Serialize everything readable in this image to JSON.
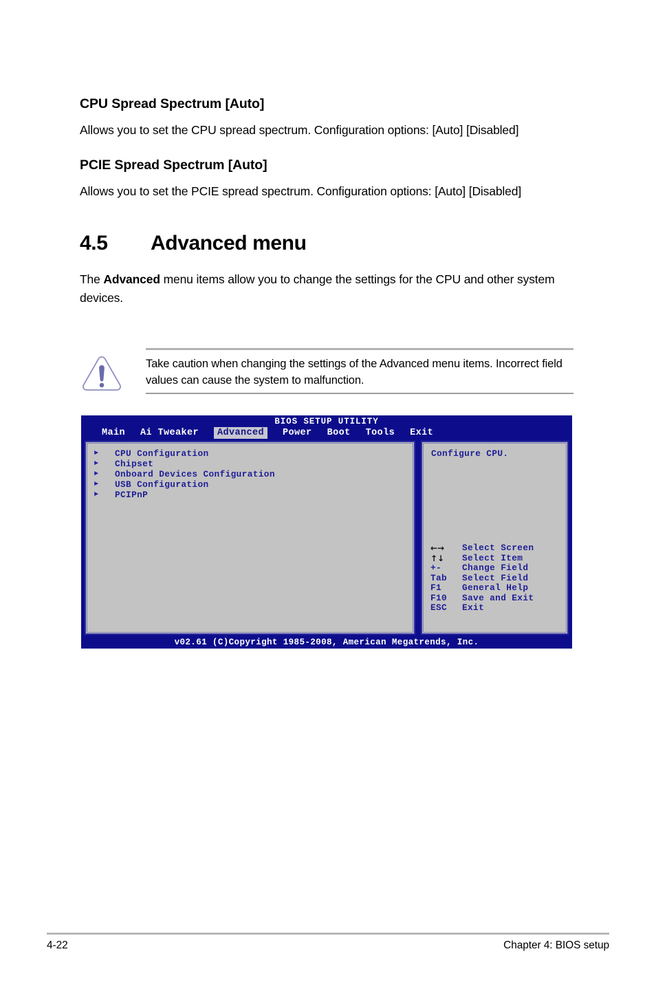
{
  "document": {
    "sections": [
      {
        "heading": "CPU Spread Spectrum [Auto]",
        "body": "Allows you to set the CPU spread spectrum. Configuration options: [Auto] [Disabled]"
      },
      {
        "heading": "PCIE Spread Spectrum [Auto]",
        "body": "Allows you to set the PCIE spread spectrum. Configuration options: [Auto] [Disabled]"
      }
    ],
    "section_heading": {
      "number": "4.5",
      "title": "Advanced menu"
    },
    "intro": {
      "prefix": "The ",
      "bold": "Advanced",
      "suffix": " menu items allow you to change the settings for the CPU and other system devices."
    },
    "note": {
      "icon": "warning-triangle-icon",
      "text": "Take caution when changing the settings of the Advanced menu items. Incorrect field values can cause the system to malfunction."
    },
    "footer": {
      "page_number": "4-22",
      "chapter": "Chapter 4: BIOS setup"
    }
  },
  "bios": {
    "title": "BIOS SETUP UTILITY",
    "tabs": [
      {
        "label": "Main",
        "active": false
      },
      {
        "label": "Ai Tweaker",
        "active": false
      },
      {
        "label": "Advanced",
        "active": true
      },
      {
        "label": "Power",
        "active": false
      },
      {
        "label": "Boot",
        "active": false
      },
      {
        "label": "Tools",
        "active": false
      },
      {
        "label": "Exit",
        "active": false
      }
    ],
    "menu_items": [
      {
        "arrow": "triangle-right-icon",
        "label": "CPU Configuration"
      },
      {
        "arrow": "triangle-right-icon",
        "label": "Chipset"
      },
      {
        "arrow": "triangle-right-icon",
        "label": "Onboard Devices Configuration"
      },
      {
        "arrow": "triangle-right-icon",
        "label": "USB Configuration"
      },
      {
        "arrow": "triangle-right-icon",
        "label": "PCIPnP"
      }
    ],
    "help_text": "Configure CPU.",
    "legend": [
      {
        "key": "←→",
        "desc": "Select Screen",
        "glyph": true
      },
      {
        "key": "↑↓",
        "desc": "Select Item",
        "glyph": true
      },
      {
        "key": "+-",
        "desc": "Change Field",
        "glyph": false
      },
      {
        "key": "Tab",
        "desc": "Select Field",
        "glyph": false
      },
      {
        "key": "F1",
        "desc": "General Help",
        "glyph": false
      },
      {
        "key": "F10",
        "desc": "Save and Exit",
        "glyph": false
      },
      {
        "key": "ESC",
        "desc": "Exit",
        "glyph": false
      }
    ],
    "footer": "v02.61 (C)Copyright 1985-2008, American Megatrends, Inc.",
    "colors": {
      "background": "#0d0d8c",
      "panel_background": "#c3c3c3",
      "panel_border": "#2f2fa0",
      "text": "#1f1f96",
      "active_tab_background": "#c6c6d2",
      "header_text": "#ffffff"
    }
  }
}
